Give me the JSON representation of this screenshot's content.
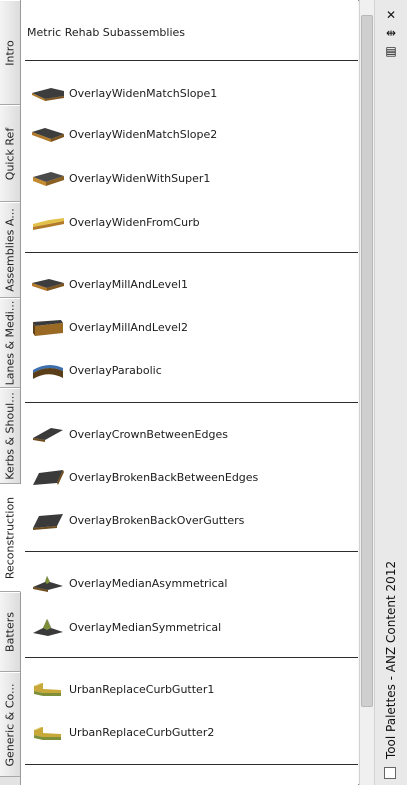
{
  "tabs": [
    {
      "label": "Intro",
      "active": false
    },
    {
      "label": "Quick Ref",
      "active": false
    },
    {
      "label": "Assemblies A...",
      "active": false
    },
    {
      "label": "Lanes & Medi...",
      "active": false
    },
    {
      "label": "Kerbs & Shoul...",
      "active": false
    },
    {
      "label": "Reconstruction",
      "active": true
    },
    {
      "label": "Batters",
      "active": false
    },
    {
      "label": "Generic & Co...",
      "active": false
    }
  ],
  "palette": {
    "title": "Metric Rehab Subassemblies",
    "groups": [
      [
        "OverlayWidenMatchSlope1",
        "OverlayWidenMatchSlope2",
        "OverlayWidenWithSuper1",
        "OverlayWidenFromCurb"
      ],
      [
        "OverlayMillAndLevel1",
        "OverlayMillAndLevel2",
        "OverlayParabolic"
      ],
      [
        "OverlayCrownBetweenEdges",
        "OverlayBrokenBackBetweenEdges",
        "OverlayBrokenBackOverGutters"
      ],
      [
        "OverlayMedianAsymmetrical",
        "OverlayMedianSymmetrical"
      ],
      [
        "UrbanReplaceCurbGutter1",
        "UrbanReplaceCurbGutter2"
      ]
    ]
  },
  "titlebar": {
    "title": "Tool Palettes - ANZ Content 2012",
    "close_glyph": "✕",
    "autohide_glyph": "⇹",
    "properties_glyph": "▤"
  },
  "colors": {
    "asphalt": "#3d3d3d",
    "base": "#b07a2a",
    "curb": "#c9a83a",
    "gutter": "#7e8f3a"
  }
}
